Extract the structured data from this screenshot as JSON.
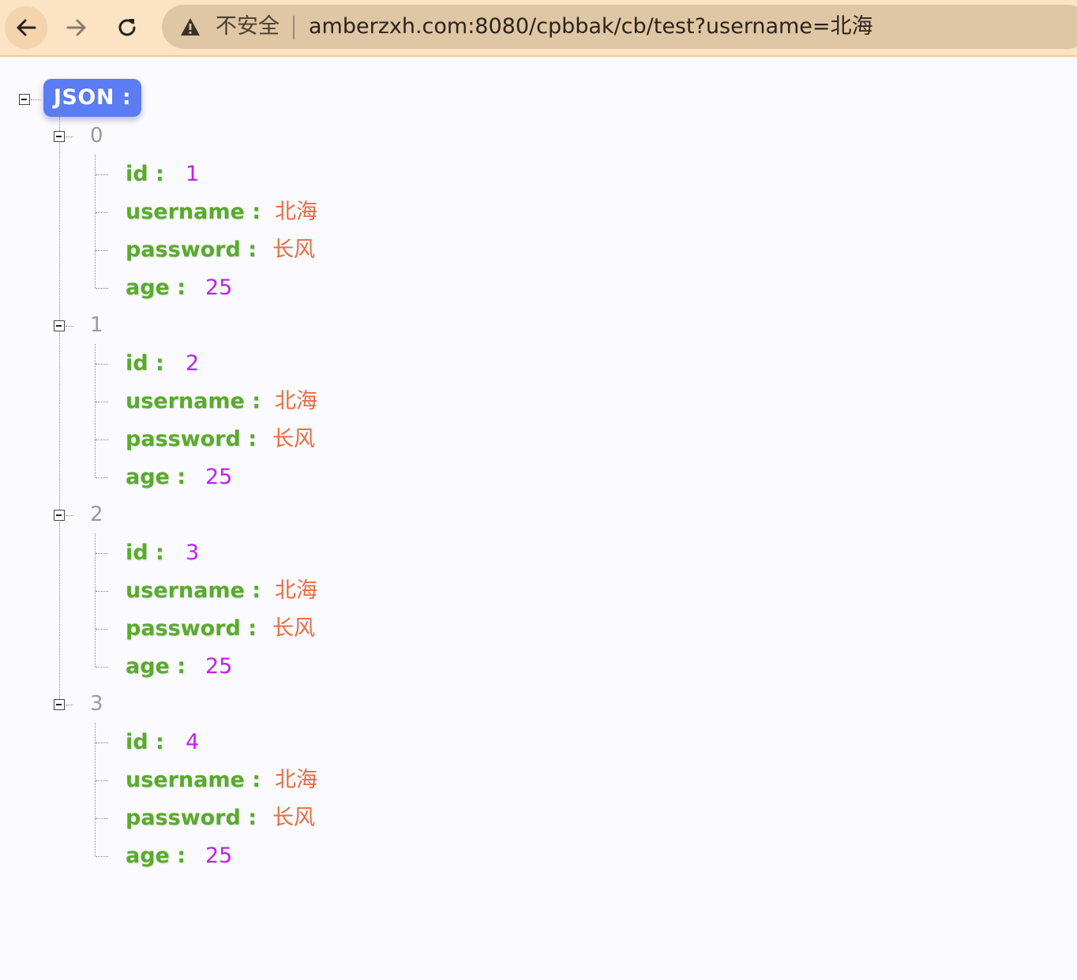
{
  "browser": {
    "security_label": "不安全",
    "url": "amberzxh.com:8080/cpbbak/cb/test?username=北海"
  },
  "json_view": {
    "root_label": "JSON :",
    "items": [
      {
        "index": "0",
        "id": "1",
        "username": "北海",
        "password": "长风",
        "age": "25"
      },
      {
        "index": "1",
        "id": "2",
        "username": "北海",
        "password": "长风",
        "age": "25"
      },
      {
        "index": "2",
        "id": "3",
        "username": "北海",
        "password": "长风",
        "age": "25"
      },
      {
        "index": "3",
        "id": "4",
        "username": "北海",
        "password": "长风",
        "age": "25"
      }
    ],
    "keys": {
      "id": "id :",
      "username": "username :",
      "password": "password :",
      "age": "age :"
    }
  },
  "colors": {
    "key": "#5aab2b",
    "number": "#c020ee",
    "string": "#ec6a3c",
    "root_badge": "#5b7cf2",
    "toolbar": "#fbe3c4"
  },
  "icons": [
    "back-arrow-icon",
    "forward-arrow-icon",
    "reload-icon",
    "warning-icon",
    "collapse-icon"
  ]
}
